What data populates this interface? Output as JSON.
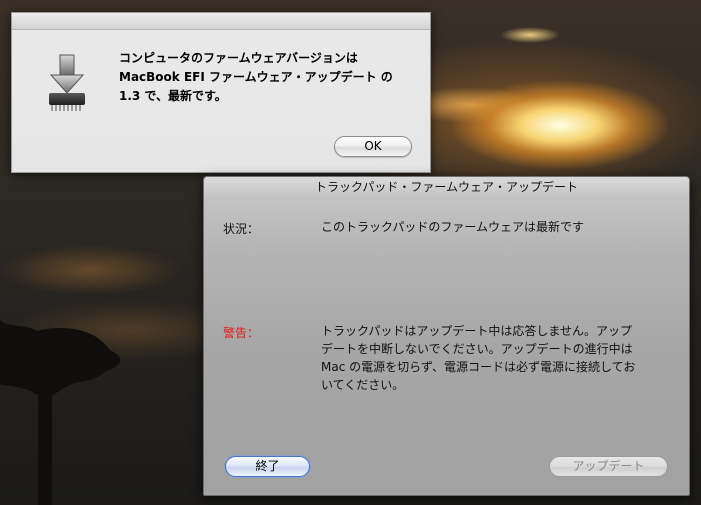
{
  "alert": {
    "icon": "firmware-update-icon",
    "message": "コンピュータのファームウェアバージョンは\nMacBook EFI ファームウェア・アップデート の\n1.3 で、最新です。",
    "ok_label": "OK"
  },
  "updater": {
    "title": "トラックパッド・ファームウェア・アップデート",
    "status_label": "状況：",
    "status_text": "このトラックパッドのファームウェアは最新です",
    "warning_label": "警告：",
    "warning_text": "トラックパッドはアップデート中は応答しません。アップ\nデートを中断しないでください。アップデートの進行中は\nMac の電源を切らず、電源コードは必ず電源に接続してお\nいてください。",
    "quit_label": "終了",
    "update_label": "アップデート",
    "warning_color": "#e21b1b"
  }
}
